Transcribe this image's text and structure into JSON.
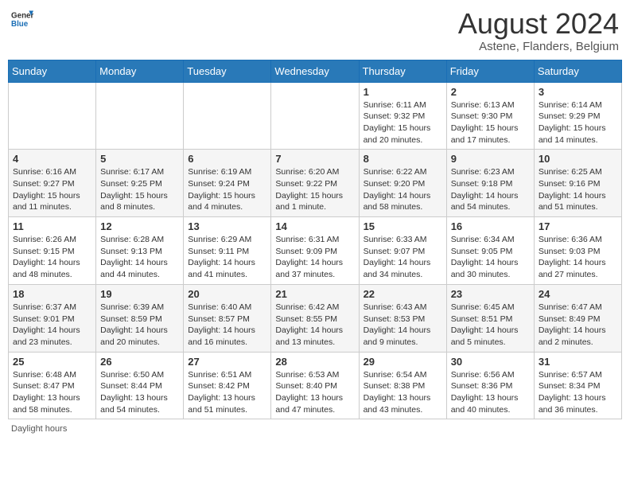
{
  "header": {
    "logo_general": "General",
    "logo_blue": "Blue",
    "title": "August 2024",
    "subtitle": "Astene, Flanders, Belgium"
  },
  "calendar": {
    "days_of_week": [
      "Sunday",
      "Monday",
      "Tuesday",
      "Wednesday",
      "Thursday",
      "Friday",
      "Saturday"
    ],
    "weeks": [
      [
        {
          "day": "",
          "info": ""
        },
        {
          "day": "",
          "info": ""
        },
        {
          "day": "",
          "info": ""
        },
        {
          "day": "",
          "info": ""
        },
        {
          "day": "1",
          "info": "Sunrise: 6:11 AM\nSunset: 9:32 PM\nDaylight: 15 hours\nand 20 minutes."
        },
        {
          "day": "2",
          "info": "Sunrise: 6:13 AM\nSunset: 9:30 PM\nDaylight: 15 hours\nand 17 minutes."
        },
        {
          "day": "3",
          "info": "Sunrise: 6:14 AM\nSunset: 9:29 PM\nDaylight: 15 hours\nand 14 minutes."
        }
      ],
      [
        {
          "day": "4",
          "info": "Sunrise: 6:16 AM\nSunset: 9:27 PM\nDaylight: 15 hours\nand 11 minutes."
        },
        {
          "day": "5",
          "info": "Sunrise: 6:17 AM\nSunset: 9:25 PM\nDaylight: 15 hours\nand 8 minutes."
        },
        {
          "day": "6",
          "info": "Sunrise: 6:19 AM\nSunset: 9:24 PM\nDaylight: 15 hours\nand 4 minutes."
        },
        {
          "day": "7",
          "info": "Sunrise: 6:20 AM\nSunset: 9:22 PM\nDaylight: 15 hours\nand 1 minute."
        },
        {
          "day": "8",
          "info": "Sunrise: 6:22 AM\nSunset: 9:20 PM\nDaylight: 14 hours\nand 58 minutes."
        },
        {
          "day": "9",
          "info": "Sunrise: 6:23 AM\nSunset: 9:18 PM\nDaylight: 14 hours\nand 54 minutes."
        },
        {
          "day": "10",
          "info": "Sunrise: 6:25 AM\nSunset: 9:16 PM\nDaylight: 14 hours\nand 51 minutes."
        }
      ],
      [
        {
          "day": "11",
          "info": "Sunrise: 6:26 AM\nSunset: 9:15 PM\nDaylight: 14 hours\nand 48 minutes."
        },
        {
          "day": "12",
          "info": "Sunrise: 6:28 AM\nSunset: 9:13 PM\nDaylight: 14 hours\nand 44 minutes."
        },
        {
          "day": "13",
          "info": "Sunrise: 6:29 AM\nSunset: 9:11 PM\nDaylight: 14 hours\nand 41 minutes."
        },
        {
          "day": "14",
          "info": "Sunrise: 6:31 AM\nSunset: 9:09 PM\nDaylight: 14 hours\nand 37 minutes."
        },
        {
          "day": "15",
          "info": "Sunrise: 6:33 AM\nSunset: 9:07 PM\nDaylight: 14 hours\nand 34 minutes."
        },
        {
          "day": "16",
          "info": "Sunrise: 6:34 AM\nSunset: 9:05 PM\nDaylight: 14 hours\nand 30 minutes."
        },
        {
          "day": "17",
          "info": "Sunrise: 6:36 AM\nSunset: 9:03 PM\nDaylight: 14 hours\nand 27 minutes."
        }
      ],
      [
        {
          "day": "18",
          "info": "Sunrise: 6:37 AM\nSunset: 9:01 PM\nDaylight: 14 hours\nand 23 minutes."
        },
        {
          "day": "19",
          "info": "Sunrise: 6:39 AM\nSunset: 8:59 PM\nDaylight: 14 hours\nand 20 minutes."
        },
        {
          "day": "20",
          "info": "Sunrise: 6:40 AM\nSunset: 8:57 PM\nDaylight: 14 hours\nand 16 minutes."
        },
        {
          "day": "21",
          "info": "Sunrise: 6:42 AM\nSunset: 8:55 PM\nDaylight: 14 hours\nand 13 minutes."
        },
        {
          "day": "22",
          "info": "Sunrise: 6:43 AM\nSunset: 8:53 PM\nDaylight: 14 hours\nand 9 minutes."
        },
        {
          "day": "23",
          "info": "Sunrise: 6:45 AM\nSunset: 8:51 PM\nDaylight: 14 hours\nand 5 minutes."
        },
        {
          "day": "24",
          "info": "Sunrise: 6:47 AM\nSunset: 8:49 PM\nDaylight: 14 hours\nand 2 minutes."
        }
      ],
      [
        {
          "day": "25",
          "info": "Sunrise: 6:48 AM\nSunset: 8:47 PM\nDaylight: 13 hours\nand 58 minutes."
        },
        {
          "day": "26",
          "info": "Sunrise: 6:50 AM\nSunset: 8:44 PM\nDaylight: 13 hours\nand 54 minutes."
        },
        {
          "day": "27",
          "info": "Sunrise: 6:51 AM\nSunset: 8:42 PM\nDaylight: 13 hours\nand 51 minutes."
        },
        {
          "day": "28",
          "info": "Sunrise: 6:53 AM\nSunset: 8:40 PM\nDaylight: 13 hours\nand 47 minutes."
        },
        {
          "day": "29",
          "info": "Sunrise: 6:54 AM\nSunset: 8:38 PM\nDaylight: 13 hours\nand 43 minutes."
        },
        {
          "day": "30",
          "info": "Sunrise: 6:56 AM\nSunset: 8:36 PM\nDaylight: 13 hours\nand 40 minutes."
        },
        {
          "day": "31",
          "info": "Sunrise: 6:57 AM\nSunset: 8:34 PM\nDaylight: 13 hours\nand 36 minutes."
        }
      ]
    ]
  },
  "footer": {
    "text": "Daylight hours"
  }
}
